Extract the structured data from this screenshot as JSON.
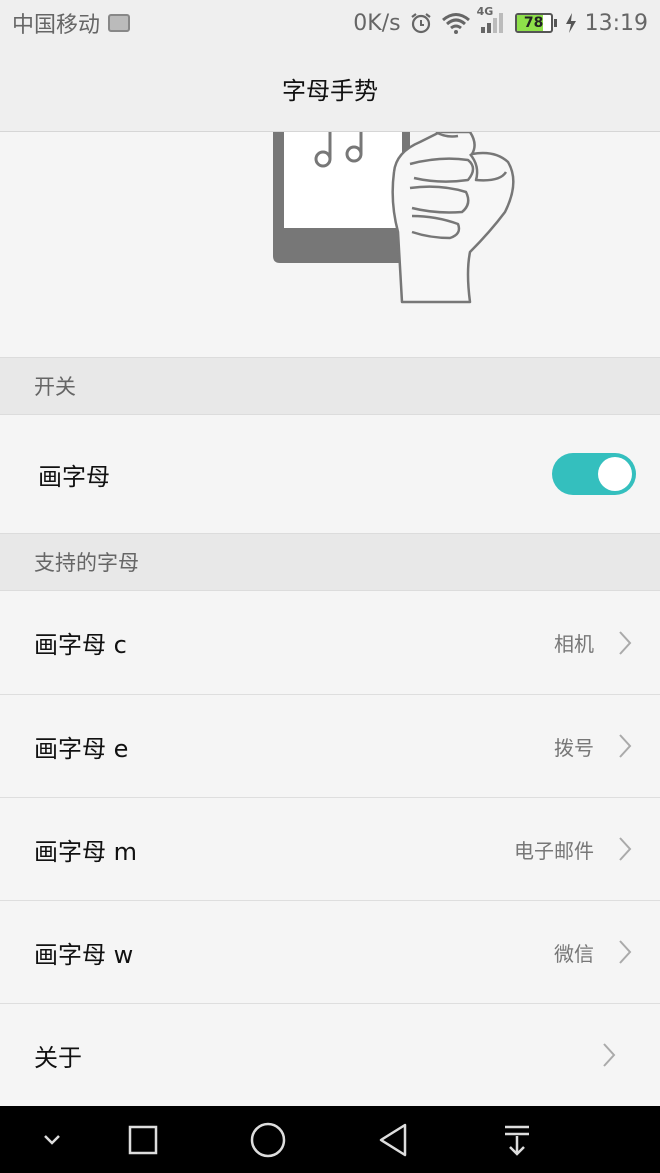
{
  "status_bar": {
    "carrier": "中国移动",
    "speed": "0K/s",
    "network": "4G",
    "battery_level": "78",
    "time": "13:19",
    "icons": [
      "image-icon",
      "alarm-icon",
      "wifi-icon",
      "signal-icon",
      "battery-icon",
      "charging-icon"
    ]
  },
  "header": {
    "title": "字母手势"
  },
  "sections": {
    "switch_header": "开关",
    "letters_header": "支持的字母"
  },
  "toggle_row": {
    "label": "画字母",
    "enabled": true
  },
  "letter_rows": [
    {
      "label": "画字母 c",
      "value": "相机"
    },
    {
      "label": "画字母 e",
      "value": "拨号"
    },
    {
      "label": "画字母 m",
      "value": "电子邮件"
    },
    {
      "label": "画字母 w",
      "value": "微信"
    }
  ],
  "about_row": {
    "label": "关于"
  },
  "colors": {
    "accent": "#34bfbe",
    "background": "#f5f5f5",
    "section_header": "#e8e8e8",
    "battery_fill": "#8ee04a"
  },
  "nav_bar_icons": [
    "chevron-down-icon",
    "recents-square-icon",
    "home-circle-icon",
    "back-triangle-icon",
    "notification-pull-icon"
  ]
}
